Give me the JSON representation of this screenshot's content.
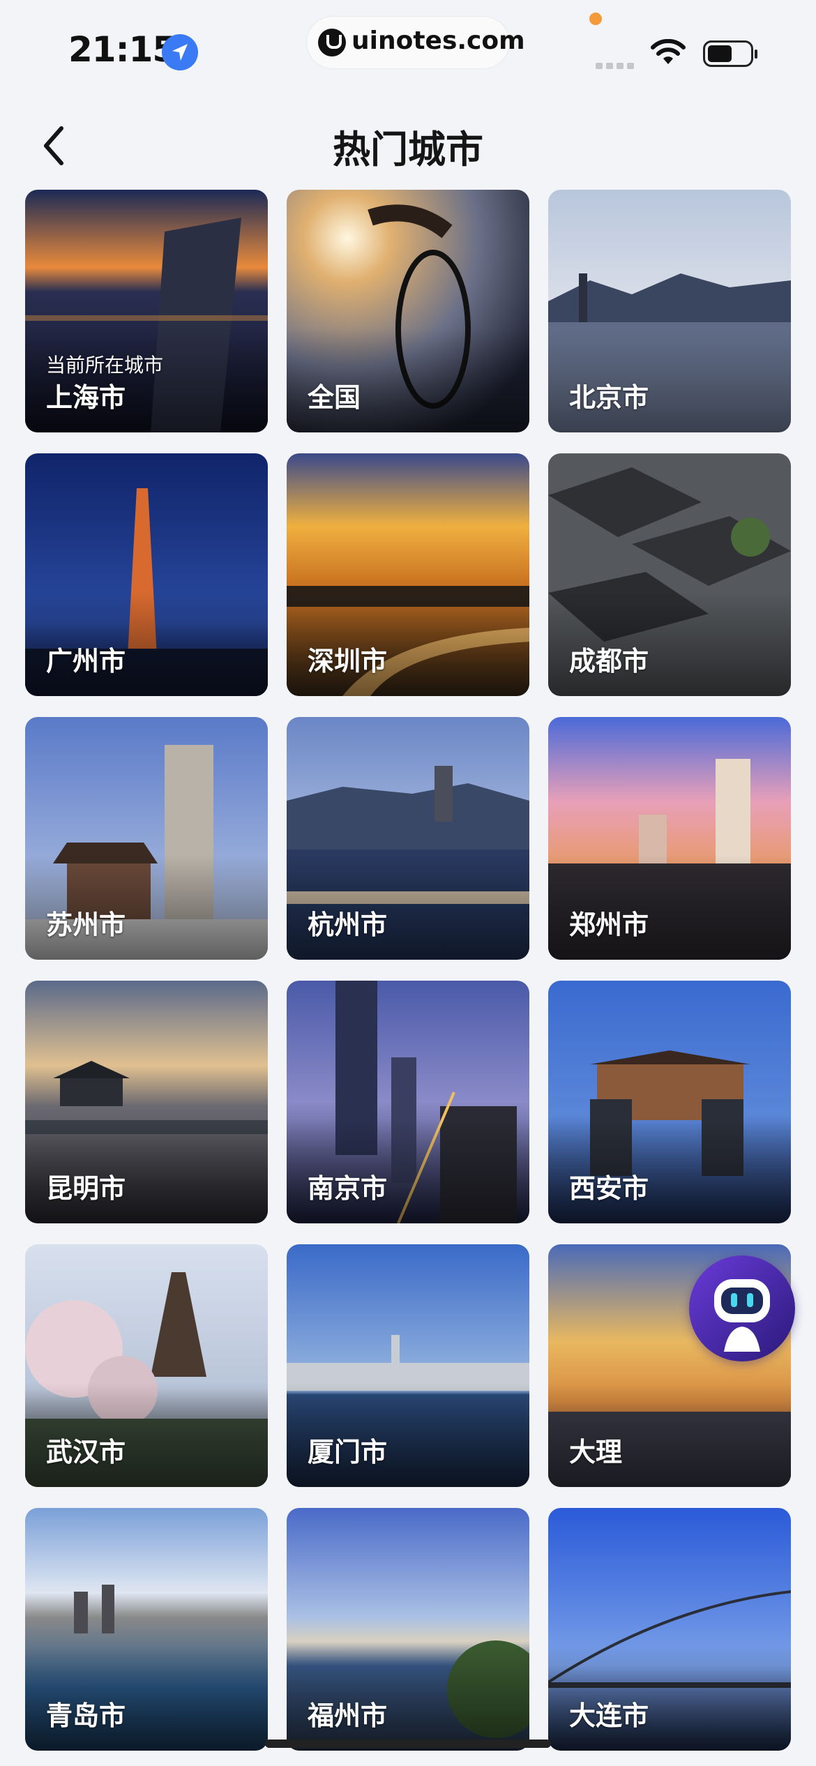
{
  "status_bar": {
    "time": "21:15",
    "url": "uinotes.com"
  },
  "header": {
    "title": "热门城市"
  },
  "cities": [
    {
      "name": "上海市",
      "subtitle": "当前所在城市"
    },
    {
      "name": "全国"
    },
    {
      "name": "北京市"
    },
    {
      "name": "广州市"
    },
    {
      "name": "深圳市"
    },
    {
      "name": "成都市"
    },
    {
      "name": "苏州市"
    },
    {
      "name": "杭州市"
    },
    {
      "name": "郑州市"
    },
    {
      "name": "昆明市"
    },
    {
      "name": "南京市"
    },
    {
      "name": "西安市"
    },
    {
      "name": "武汉市"
    },
    {
      "name": "厦门市"
    },
    {
      "name": "大理"
    },
    {
      "name": "青岛市"
    },
    {
      "name": "福州市"
    },
    {
      "name": "大连市"
    }
  ],
  "icons": {
    "location": "location-arrow-icon",
    "back": "chevron-left-icon",
    "assistant": "robot-assistant-icon"
  },
  "colors": {
    "background": "#f3f4f8",
    "location_blue": "#3a7bf5",
    "notification_orange": "#f59a3a"
  }
}
